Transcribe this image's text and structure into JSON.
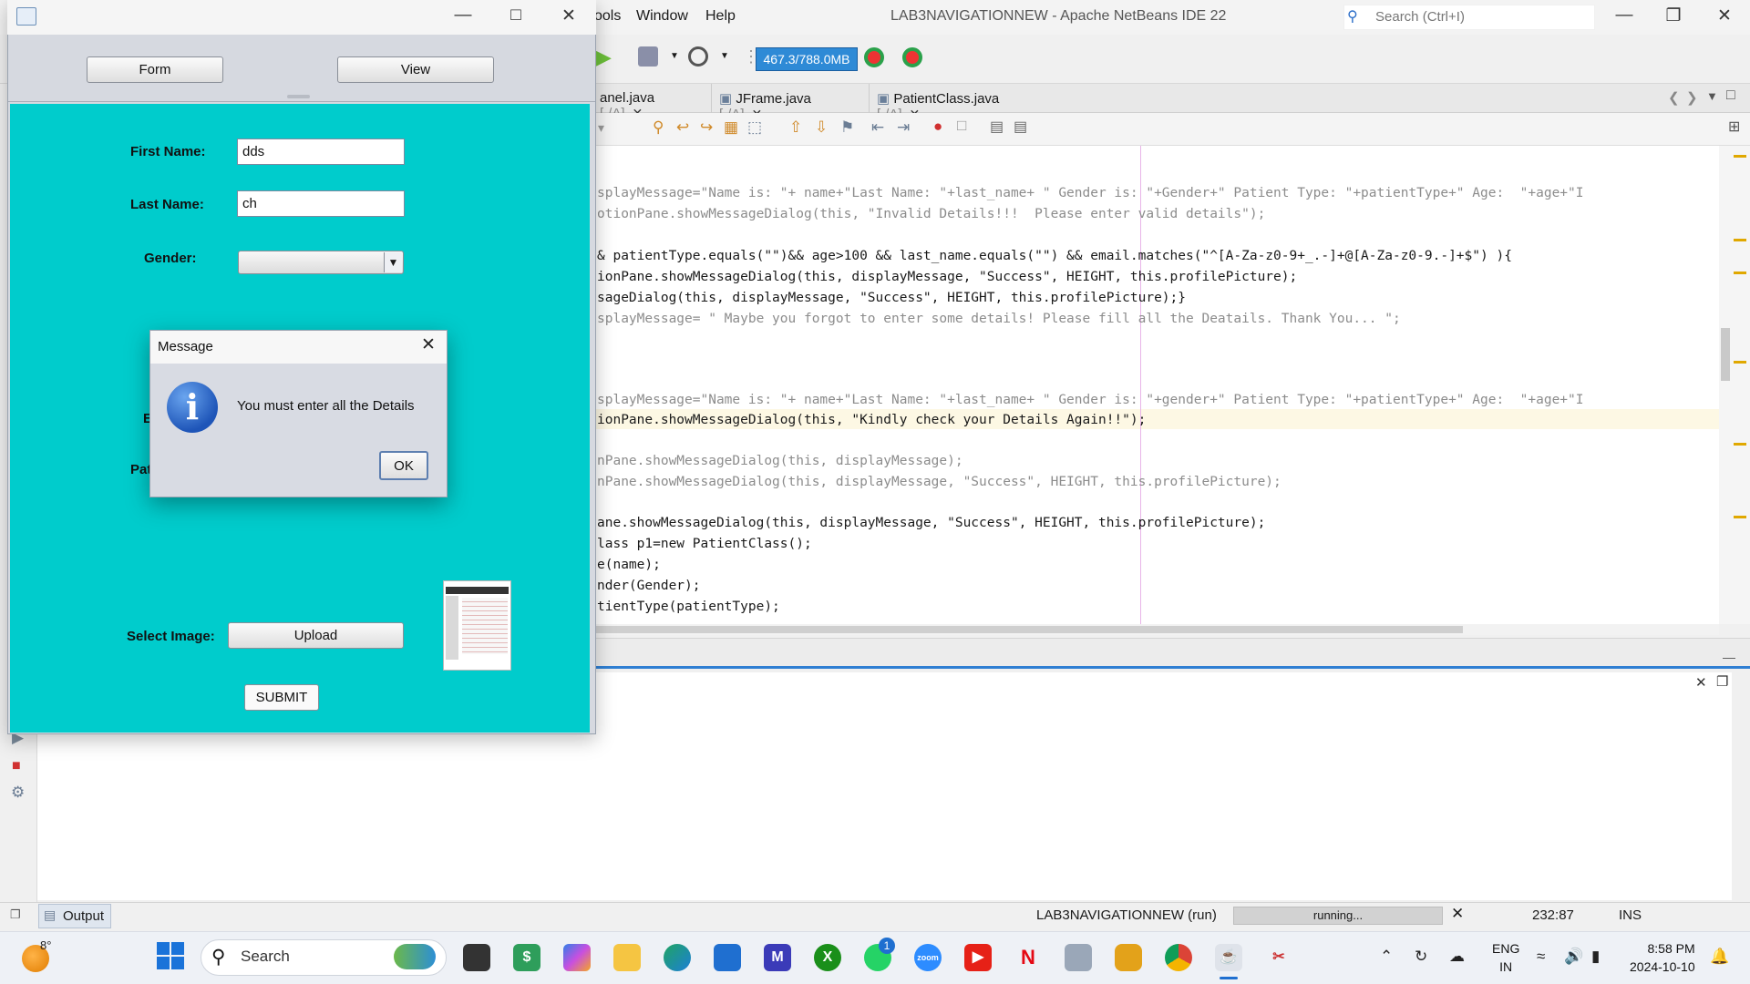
{
  "ide": {
    "title": "LAB3NAVIGATIONNEW - Apache NetBeans IDE 22",
    "menu": [
      "ools",
      "Window",
      "Help"
    ],
    "search_placeholder": "Search (Ctrl+I)",
    "memory": "467.3/788.0MB",
    "tabs": [
      {
        "name": "anel.java",
        "path": "[-/A]"
      },
      {
        "name": "JFrame.java",
        "path": "[-/A]"
      },
      {
        "name": "PatientClass.java",
        "path": "[-/A]"
      }
    ],
    "status": {
      "output_tab": "Output",
      "project": "LAB3NAVIGATIONNEW (run)",
      "progress": "running...",
      "position": "232:87",
      "mode": "INS"
    }
  },
  "code_lines": [
    "splayMessage=\"Name is: \"+ name+\"Last Name: \"+last_name+ \" Gender is: \"+Gender+\" Patient Type: \"+patientType+\" Age:  \"+age+\"I",
    "otionPane.showMessageDialog(this, \"Invalid Details!!!  Please enter valid details\");",
    "& patientType.equals(\"\")&& age>100 && last_name.equals(\"\") && email.matches(\"^[A-Za-z0-9+_.-]+@[A-Za-z0-9.-]+$\") ){",
    "ionPane.showMessageDialog(this, displayMessage, \"Success\", HEIGHT, this.profilePicture);",
    "sageDialog(this, displayMessage, \"Success\", HEIGHT, this.profilePicture);}",
    "splayMessage= \" Maybe you forgot to enter some details! Please fill all the Deatails. Thank You... \";",
    "splayMessage=\"Name is: \"+ name+\"Last Name: \"+last_name+ \" Gender is: \"+gender+\" Patient Type: \"+patientType+\" Age:  \"+age+\"I",
    "ionPane.showMessageDialog(this, \"Kindly check your Details Again!!\");",
    "nPane.showMessageDialog(this, displayMessage);",
    "nPane.showMessageDialog(this, displayMessage, \"Success\", HEIGHT, this.profilePicture);",
    "ane.showMessageDialog(this, displayMessage, \"Success\", HEIGHT, this.profilePicture);",
    "lass p1=new PatientClass();",
    "e(name);",
    "nder(Gender);",
    "tientType(patientType);"
  ],
  "app": {
    "nav": {
      "form_label": "Form",
      "view_label": "View"
    },
    "form": {
      "first_name_label": "First Name:",
      "first_name_value": "dds",
      "last_name_label": "Last Name:",
      "last_name_value": "ch",
      "gender_label": "Gender:",
      "gender_value": "",
      "obscured_label_1": "E",
      "obscured_label_2": "Pat",
      "select_image_label": "Select Image:",
      "upload_label": "Upload",
      "submit_label": "SUBMIT"
    }
  },
  "dialog": {
    "title": "Message",
    "message": "You must enter all the Details",
    "ok_label": "OK"
  },
  "taskbar": {
    "weather_temp": "8°",
    "search_label": "Search",
    "whatsapp_badge": "1",
    "language_line1": "ENG",
    "language_line2": "IN",
    "time": "8:58 PM",
    "date": "2024-10-10"
  },
  "colors": {
    "form_background": "#00cccc",
    "memory_bar": "#2e8ad6",
    "output_accent": "#2f7fd3"
  }
}
